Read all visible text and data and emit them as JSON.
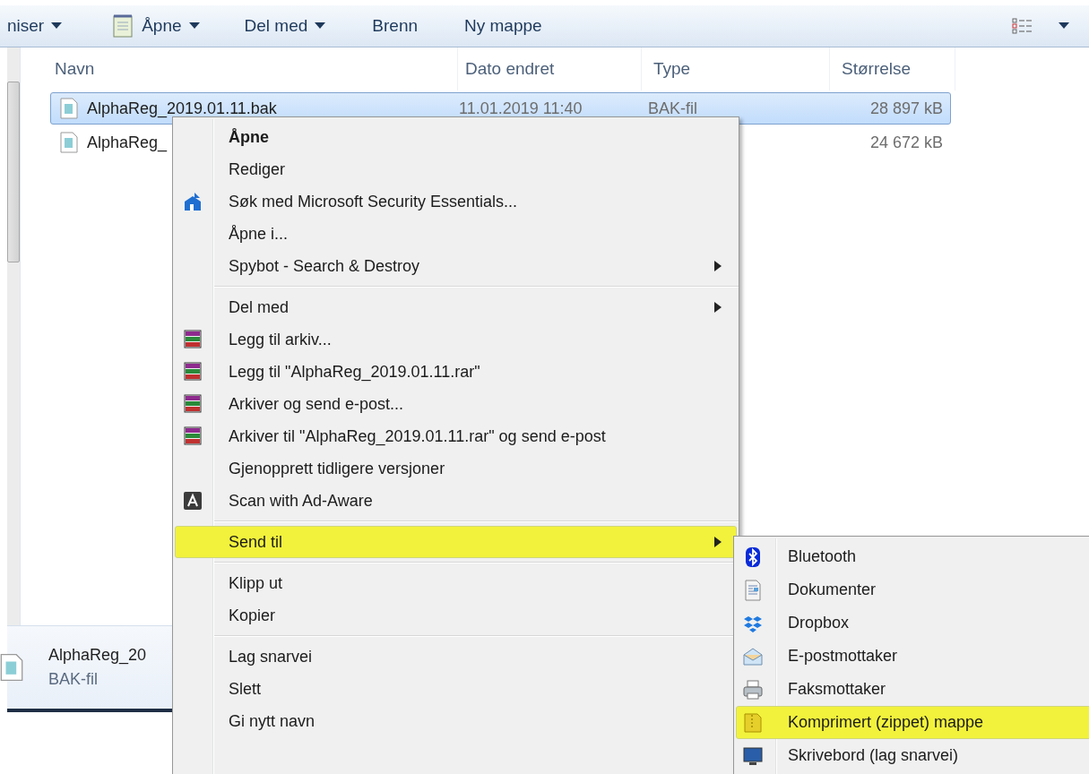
{
  "toolbar": {
    "items": [
      {
        "label": "niser",
        "dropdown": true
      },
      {
        "label": "Åpne",
        "dropdown": true
      },
      {
        "label": "Del med",
        "dropdown": true
      },
      {
        "label": "Brenn",
        "dropdown": false
      },
      {
        "label": "Ny mappe",
        "dropdown": false
      }
    ],
    "view_dropdown": true
  },
  "file_list": {
    "columns": [
      "Navn",
      "Dato endret",
      "Type",
      "Størrelse"
    ],
    "rows": [
      {
        "name": "AlphaReg_2019.01.11.bak",
        "date": "11.01.2019 11:40",
        "type": "BAK-fil",
        "size": "28 897 kB",
        "selected": true
      },
      {
        "name": "AlphaReg_",
        "size": "24 672 kB",
        "selected": false
      }
    ]
  },
  "details_pane": {
    "name": "AlphaReg_20",
    "type": "BAK-fil"
  },
  "context_menu": {
    "items": [
      {
        "kind": "item",
        "label": "Åpne",
        "default": true,
        "submenu": false,
        "selected": false
      },
      {
        "kind": "item",
        "label": "Rediger",
        "default": false,
        "submenu": false,
        "selected": false
      },
      {
        "kind": "item",
        "label": "Søk med Microsoft Security Essentials...",
        "default": false,
        "submenu": false,
        "selected": false
      },
      {
        "kind": "item",
        "label": "Åpne i...",
        "default": false,
        "submenu": false,
        "selected": false
      },
      {
        "kind": "item",
        "label": "Spybot - Search & Destroy",
        "default": false,
        "submenu": true,
        "selected": false
      },
      {
        "kind": "separator"
      },
      {
        "kind": "item",
        "label": "Del med",
        "default": false,
        "submenu": true,
        "selected": false
      },
      {
        "kind": "item",
        "label": "Legg til arkiv...",
        "default": false,
        "submenu": false,
        "selected": false
      },
      {
        "kind": "item",
        "label": "Legg til \"AlphaReg_2019.01.11.rar\"",
        "default": false,
        "submenu": false,
        "selected": false
      },
      {
        "kind": "item",
        "label": "Arkiver og send e-post...",
        "default": false,
        "submenu": false,
        "selected": false
      },
      {
        "kind": "item",
        "label": "Arkiver til \"AlphaReg_2019.01.11.rar\" og send e-post",
        "default": false,
        "submenu": false,
        "selected": false
      },
      {
        "kind": "item",
        "label": "Gjenopprett tidligere versjoner",
        "default": false,
        "submenu": false,
        "selected": false
      },
      {
        "kind": "item",
        "label": "Scan with Ad-Aware",
        "default": false,
        "submenu": false,
        "selected": false
      },
      {
        "kind": "separator"
      },
      {
        "kind": "item",
        "label": "Send til",
        "default": false,
        "submenu": true,
        "selected": true
      },
      {
        "kind": "separator"
      },
      {
        "kind": "item",
        "label": "Klipp ut",
        "default": false,
        "submenu": false,
        "selected": false
      },
      {
        "kind": "item",
        "label": "Kopier",
        "default": false,
        "submenu": false,
        "selected": false
      },
      {
        "kind": "separator"
      },
      {
        "kind": "item",
        "label": "Lag snarvei",
        "default": false,
        "submenu": false,
        "selected": false
      },
      {
        "kind": "item",
        "label": "Slett",
        "default": false,
        "submenu": false,
        "selected": false
      },
      {
        "kind": "item",
        "label": "Gi nytt navn",
        "default": false,
        "submenu": false,
        "selected": false
      }
    ]
  },
  "send_to_menu": {
    "items": [
      {
        "label": "Bluetooth",
        "selected": false
      },
      {
        "label": "Dokumenter",
        "selected": false
      },
      {
        "label": "Dropbox",
        "selected": false
      },
      {
        "label": "E-postmottaker",
        "selected": false
      },
      {
        "label": "Faksmottaker",
        "selected": false
      },
      {
        "label": "Komprimert (zippet) mappe",
        "selected": true
      },
      {
        "label": "Skrivebord (lag snarvei)",
        "selected": false
      }
    ]
  }
}
